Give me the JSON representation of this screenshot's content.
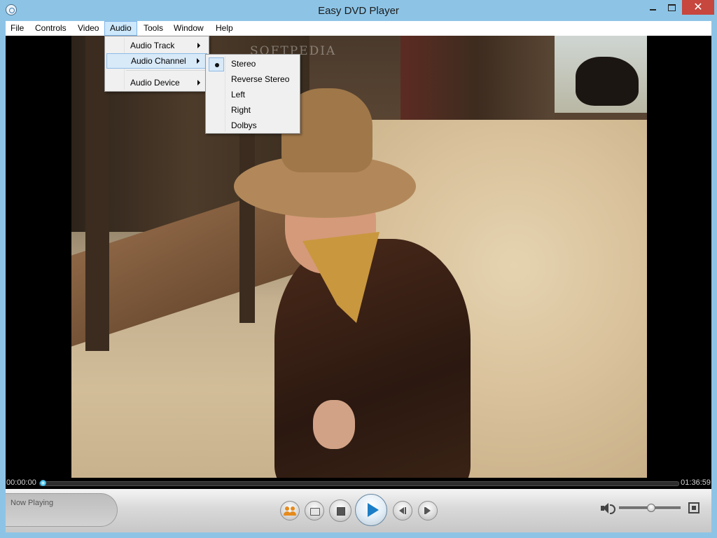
{
  "window": {
    "title": "Easy DVD Player",
    "close_glyph": "✕"
  },
  "menubar": {
    "items": [
      {
        "label": "File"
      },
      {
        "label": "Controls"
      },
      {
        "label": "Video"
      },
      {
        "label": "Audio",
        "active": true
      },
      {
        "label": "Tools"
      },
      {
        "label": "Window"
      },
      {
        "label": "Help"
      }
    ]
  },
  "audio_menu": {
    "items": [
      {
        "label": "Audio Track",
        "submenu": true
      },
      {
        "label": "Audio Channel",
        "submenu": true,
        "highlighted": true
      },
      {
        "label": "Audio Device",
        "submenu": true
      }
    ]
  },
  "channel_menu": {
    "items": [
      {
        "label": "Stereo",
        "checked": true
      },
      {
        "label": "Reverse Stereo"
      },
      {
        "label": "Left"
      },
      {
        "label": "Right"
      },
      {
        "label": "Dolbys"
      }
    ]
  },
  "video": {
    "watermark": "SOFTPEDIA"
  },
  "playback": {
    "current_time": "00:00:00",
    "total_time": "01:36:59",
    "progress": 0.0
  },
  "controls": {
    "now_playing_label": "Now Playing",
    "volume_level": 0.52
  },
  "colors": {
    "title_bar": "#8dc4e6",
    "close_button": "#c7463d",
    "menu_highlight": "#cde8fb",
    "play_arrow": "#1c7ec7",
    "seek_knob": "#4ecdf5"
  },
  "icons": {
    "app": "dvd-disc-icon",
    "people": "people-icon",
    "open": "folder-icon",
    "stop": "stop-icon",
    "play": "play-icon",
    "prev": "previous-icon",
    "next": "next-icon",
    "volume": "speaker-icon",
    "fullscreen": "fullscreen-icon"
  }
}
